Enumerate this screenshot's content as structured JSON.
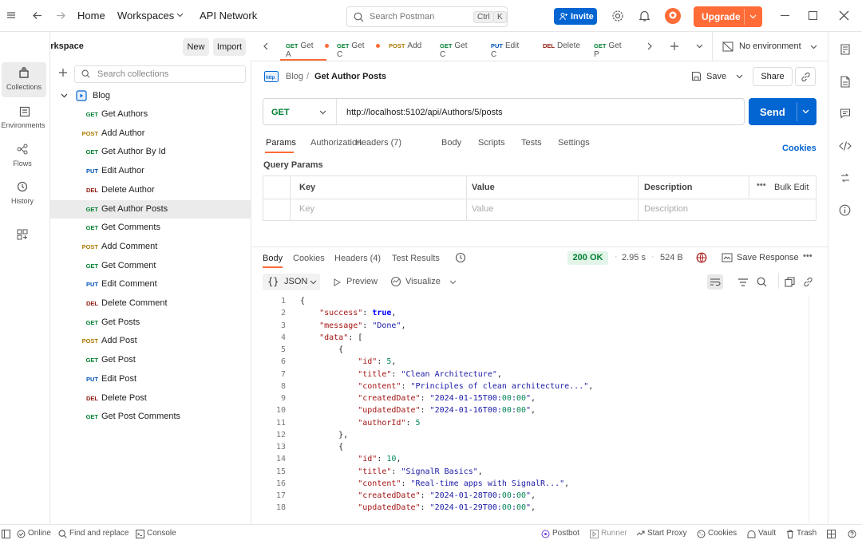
{
  "topbar": {
    "home": "Home",
    "workspaces": "Workspaces",
    "api_network": "API Network",
    "search_placeholder": "Search Postman",
    "kbd_ctrl": "Ctrl",
    "kbd_k": "K",
    "invite": "Invite",
    "upgrade": "Upgrade"
  },
  "nav": {
    "collections": "Collections",
    "environments": "Environments",
    "flows": "Flows",
    "history": "History"
  },
  "workspace": {
    "title": "My Workspace",
    "new_label": "New",
    "import_label": "Import",
    "search_placeholder": "Search collections"
  },
  "collection": {
    "name": "Blog",
    "items": [
      {
        "method": "GET",
        "name": "Get Authors"
      },
      {
        "method": "POST",
        "name": "Add Author"
      },
      {
        "method": "GET",
        "name": "Get Author By Id"
      },
      {
        "method": "PUT",
        "name": "Edit Author"
      },
      {
        "method": "DEL",
        "name": "Delete Author"
      },
      {
        "method": "GET",
        "name": "Get Author Posts"
      },
      {
        "method": "GET",
        "name": "Get Comments"
      },
      {
        "method": "POST",
        "name": "Add Comment"
      },
      {
        "method": "GET",
        "name": "Get Comment"
      },
      {
        "method": "PUT",
        "name": "Edit Comment"
      },
      {
        "method": "DEL",
        "name": "Delete Comment"
      },
      {
        "method": "GET",
        "name": "Get Posts"
      },
      {
        "method": "POST",
        "name": "Add Post"
      },
      {
        "method": "GET",
        "name": "Get Post"
      },
      {
        "method": "PUT",
        "name": "Edit Post"
      },
      {
        "method": "DEL",
        "name": "Delete Post"
      },
      {
        "method": "GET",
        "name": "Get Post Comments"
      }
    ]
  },
  "tabs": [
    {
      "method": "GET",
      "name": "Get A"
    },
    {
      "method": "GET",
      "name": "Get C"
    },
    {
      "method": "POST",
      "name": "Add"
    },
    {
      "method": "GET",
      "name": "Get C"
    },
    {
      "method": "PUT",
      "name": "Edit C"
    },
    {
      "method": "DEL",
      "name": "Delete"
    },
    {
      "method": "GET",
      "name": "Get P"
    }
  ],
  "environment": "No environment",
  "request": {
    "breadcrumb_parent": "Blog",
    "breadcrumb_sep": "/",
    "title": "Get Author Posts",
    "save": "Save",
    "share": "Share",
    "method": "GET",
    "url": "http://localhost:5102/api/Authors/5/posts",
    "send": "Send"
  },
  "req_tabs": [
    "Params",
    "Authorization",
    "Headers (7)",
    "Body",
    "Scripts",
    "Tests",
    "Settings"
  ],
  "cookies": "Cookies",
  "query": {
    "title": "Query Params",
    "headers": [
      "Key",
      "Value",
      "Description"
    ],
    "bulk_edit": "Bulk Edit",
    "placeholders": [
      "Key",
      "Value",
      "Description"
    ]
  },
  "response": {
    "tabs": [
      "Body",
      "Cookies",
      "Headers (4)",
      "Test Results"
    ],
    "status": "200 OK",
    "time": "2.95 s",
    "size": "524 B",
    "save_response": "Save Response",
    "format": "JSON",
    "preview": "Preview",
    "visualize": "Visualize"
  },
  "code": [
    [
      "1",
      "{"
    ],
    [
      "2",
      "    \"success\": true,"
    ],
    [
      "3",
      "    \"message\": \"Done\","
    ],
    [
      "4",
      "    \"data\": ["
    ],
    [
      "5",
      "        {"
    ],
    [
      "6",
      "            \"id\": 5,"
    ],
    [
      "7",
      "            \"title\": \"Clean Architecture\","
    ],
    [
      "8",
      "            \"content\": \"Principles of clean architecture...\","
    ],
    [
      "9",
      "            \"createdDate\": \"2024-01-15T00:00:00\","
    ],
    [
      "10",
      "            \"updatedDate\": \"2024-01-16T00:00:00\","
    ],
    [
      "11",
      "            \"authorId\": 5"
    ],
    [
      "12",
      "        },"
    ],
    [
      "13",
      "        {"
    ],
    [
      "14",
      "            \"id\": 10,"
    ],
    [
      "15",
      "            \"title\": \"SignalR Basics\","
    ],
    [
      "16",
      "            \"content\": \"Real-time apps with SignalR...\","
    ],
    [
      "17",
      "            \"createdDate\": \"2024-01-28T00:00:00\","
    ],
    [
      "18",
      "            \"updatedDate\": \"2024-01-29T00:00:00\","
    ]
  ],
  "statusbar": {
    "online": "Online",
    "find_replace": "Find and replace",
    "console": "Console",
    "postbot": "Postbot",
    "runner": "Runner",
    "start_proxy": "Start Proxy",
    "cookies": "Cookies",
    "vault": "Vault",
    "trash": "Trash"
  },
  "colors": {
    "get": "#007f31",
    "post": "#ad7a03",
    "put": "#0053b8",
    "del": "#8e1a10",
    "accent": "#ff6c37",
    "send": "#0265d2"
  }
}
